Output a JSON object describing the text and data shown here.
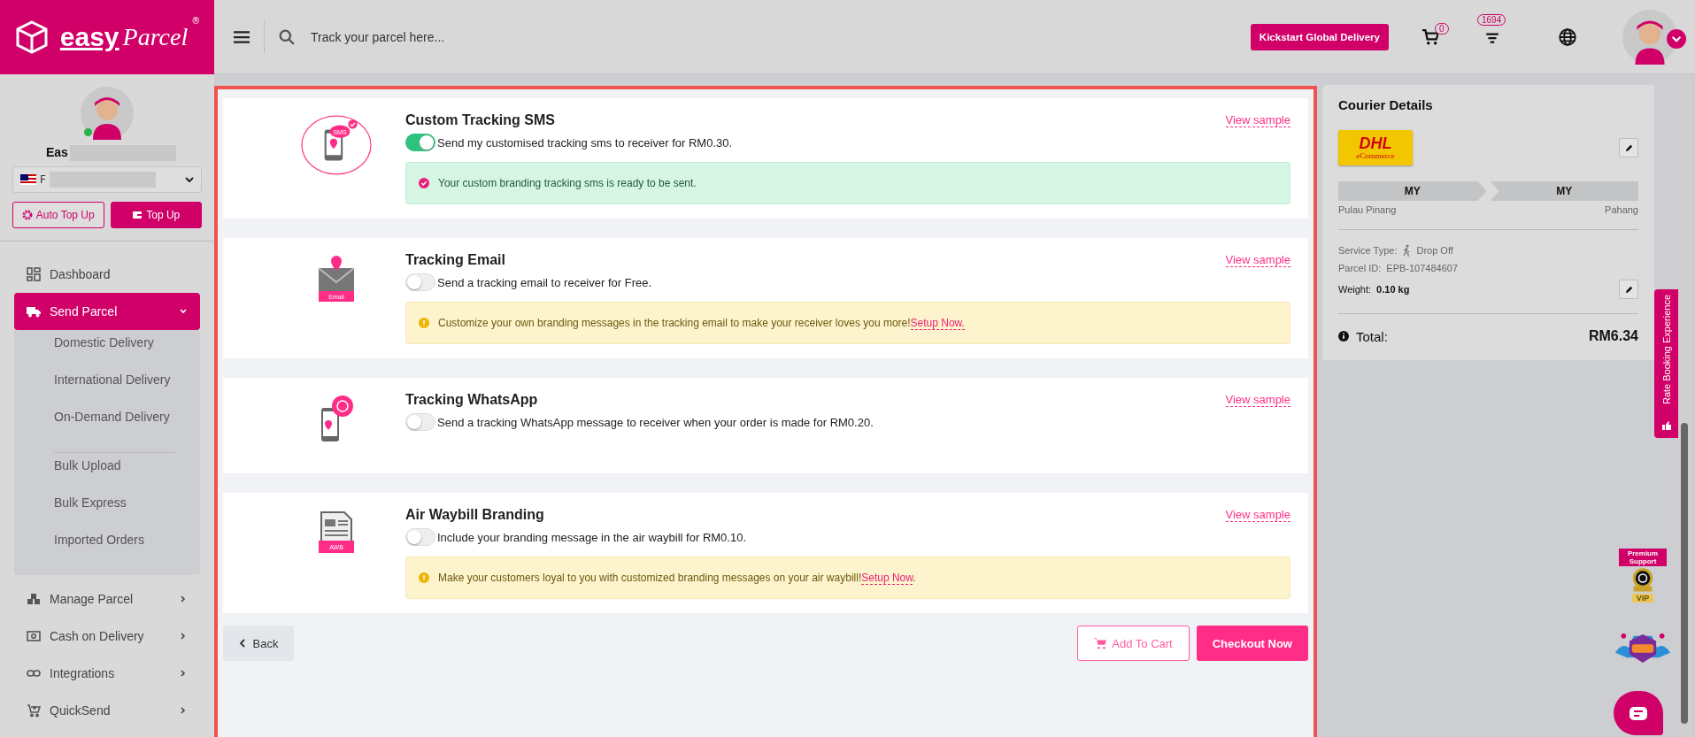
{
  "brand": {
    "word1": "easy",
    "word2": "Parcel",
    "mark": "®"
  },
  "user": {
    "name": "Eas",
    "account": "F"
  },
  "wallet_buttons": [
    {
      "label": "Auto Top Up",
      "kind": "outline"
    },
    {
      "label": "Top Up",
      "kind": "filled"
    }
  ],
  "nav": [
    {
      "label": "Dashboard",
      "kind": "dashboard",
      "selected": false,
      "has_arrow": false
    },
    {
      "label": "Send Parcel",
      "kind": "truck",
      "selected": true,
      "has_arrow": true,
      "expanded": true,
      "groups": [
        [
          "Domestic Delivery",
          "International Delivery",
          "On-Demand Delivery"
        ],
        [
          "Bulk Upload",
          "Bulk Express",
          "Imported Orders"
        ]
      ]
    },
    {
      "label": "Manage Parcel",
      "kind": "boxes",
      "selected": false,
      "has_arrow": true
    },
    {
      "label": "Cash on Delivery",
      "kind": "cash",
      "selected": false,
      "has_arrow": true
    },
    {
      "label": "Integrations",
      "kind": "link",
      "selected": false,
      "has_arrow": true
    },
    {
      "label": "QuickSend",
      "kind": "cartplus",
      "selected": false,
      "has_arrow": true
    }
  ],
  "header": {
    "search": {
      "placeholder": "Track your parcel here..."
    },
    "cta": "Kickstart Global Delivery",
    "cart_count": "0",
    "notice_count": "1694"
  },
  "options": [
    {
      "title": "Custom Tracking SMS",
      "kind": "sms",
      "on": true,
      "description": "Send my customised tracking sms to receiver for RM0.30.",
      "sample": "View sample",
      "alert": {
        "kind": "success",
        "text": "Your custom branding tracking sms is ready to be sent."
      }
    },
    {
      "title": "Tracking Email",
      "kind": "email",
      "on": false,
      "description": "Send a tracking email to receiver for Free.",
      "sample": "View sample",
      "alert": {
        "kind": "warning",
        "text": "Customize your own branding messages in the tracking email to make your receiver loves you more!",
        "link": "Setup Now."
      }
    },
    {
      "title": "Tracking WhatsApp",
      "kind": "whatsapp",
      "on": false,
      "description": "Send a tracking WhatsApp message to receiver when your order is made for RM0.20.",
      "sample": "View sample"
    },
    {
      "title": "Air Waybill Branding",
      "kind": "awb",
      "on": false,
      "description": "Include your branding message in the air waybill for RM0.10.",
      "sample": "View sample",
      "alert": {
        "kind": "warning",
        "text": "Make your customers loyal to you with customized branding messages on your air waybill!",
        "link": "Setup Now",
        "after": "."
      }
    }
  ],
  "icon_labels": {
    "sms": "SMS",
    "email": "Email",
    "awb": "AWB"
  },
  "actions": {
    "back": "Back",
    "add_to_cart": "Add To Cart",
    "checkout": "Checkout Now"
  },
  "courier": {
    "heading": "Courier Details",
    "logo_name": "DHL",
    "logo_sub": "eCommerce",
    "from": {
      "country": "MY",
      "state": "Pulau Pinang"
    },
    "to": {
      "country": "MY",
      "state": "Pahang"
    },
    "service_label": "Service Type:",
    "service": "Drop Off",
    "parcel_label": "Parcel ID:",
    "parcel_id": "EPB-107484607",
    "weight_label": "Weight:",
    "weight": "0.10 kg",
    "total_label": "Total:",
    "total": "RM6.34"
  },
  "rate_tab": "Rate Booking Experience",
  "support_badge": "Premium Support",
  "vip": "VIP"
}
